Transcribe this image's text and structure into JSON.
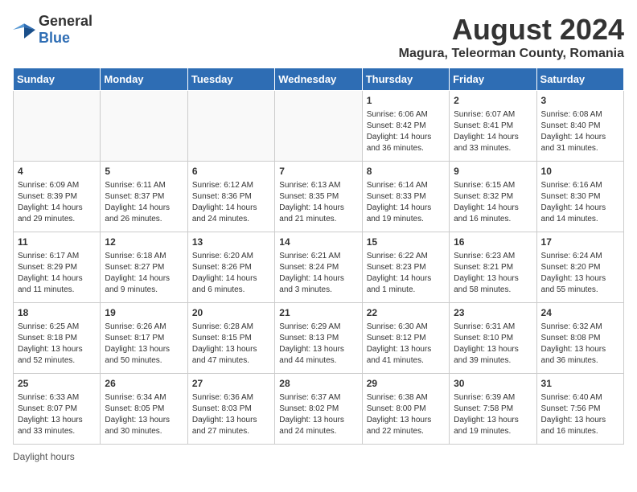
{
  "header": {
    "logo_general": "General",
    "logo_blue": "Blue",
    "title": "August 2024",
    "subtitle": "Magura, Teleorman County, Romania"
  },
  "weekdays": [
    "Sunday",
    "Monday",
    "Tuesday",
    "Wednesday",
    "Thursday",
    "Friday",
    "Saturday"
  ],
  "footer": {
    "daylight_label": "Daylight hours"
  },
  "weeks": [
    [
      {
        "day": "",
        "info": ""
      },
      {
        "day": "",
        "info": ""
      },
      {
        "day": "",
        "info": ""
      },
      {
        "day": "",
        "info": ""
      },
      {
        "day": "1",
        "info": "Sunrise: 6:06 AM\nSunset: 8:42 PM\nDaylight: 14 hours\nand 36 minutes."
      },
      {
        "day": "2",
        "info": "Sunrise: 6:07 AM\nSunset: 8:41 PM\nDaylight: 14 hours\nand 33 minutes."
      },
      {
        "day": "3",
        "info": "Sunrise: 6:08 AM\nSunset: 8:40 PM\nDaylight: 14 hours\nand 31 minutes."
      }
    ],
    [
      {
        "day": "4",
        "info": "Sunrise: 6:09 AM\nSunset: 8:39 PM\nDaylight: 14 hours\nand 29 minutes."
      },
      {
        "day": "5",
        "info": "Sunrise: 6:11 AM\nSunset: 8:37 PM\nDaylight: 14 hours\nand 26 minutes."
      },
      {
        "day": "6",
        "info": "Sunrise: 6:12 AM\nSunset: 8:36 PM\nDaylight: 14 hours\nand 24 minutes."
      },
      {
        "day": "7",
        "info": "Sunrise: 6:13 AM\nSunset: 8:35 PM\nDaylight: 14 hours\nand 21 minutes."
      },
      {
        "day": "8",
        "info": "Sunrise: 6:14 AM\nSunset: 8:33 PM\nDaylight: 14 hours\nand 19 minutes."
      },
      {
        "day": "9",
        "info": "Sunrise: 6:15 AM\nSunset: 8:32 PM\nDaylight: 14 hours\nand 16 minutes."
      },
      {
        "day": "10",
        "info": "Sunrise: 6:16 AM\nSunset: 8:30 PM\nDaylight: 14 hours\nand 14 minutes."
      }
    ],
    [
      {
        "day": "11",
        "info": "Sunrise: 6:17 AM\nSunset: 8:29 PM\nDaylight: 14 hours\nand 11 minutes."
      },
      {
        "day": "12",
        "info": "Sunrise: 6:18 AM\nSunset: 8:27 PM\nDaylight: 14 hours\nand 9 minutes."
      },
      {
        "day": "13",
        "info": "Sunrise: 6:20 AM\nSunset: 8:26 PM\nDaylight: 14 hours\nand 6 minutes."
      },
      {
        "day": "14",
        "info": "Sunrise: 6:21 AM\nSunset: 8:24 PM\nDaylight: 14 hours\nand 3 minutes."
      },
      {
        "day": "15",
        "info": "Sunrise: 6:22 AM\nSunset: 8:23 PM\nDaylight: 14 hours\nand 1 minute."
      },
      {
        "day": "16",
        "info": "Sunrise: 6:23 AM\nSunset: 8:21 PM\nDaylight: 13 hours\nand 58 minutes."
      },
      {
        "day": "17",
        "info": "Sunrise: 6:24 AM\nSunset: 8:20 PM\nDaylight: 13 hours\nand 55 minutes."
      }
    ],
    [
      {
        "day": "18",
        "info": "Sunrise: 6:25 AM\nSunset: 8:18 PM\nDaylight: 13 hours\nand 52 minutes."
      },
      {
        "day": "19",
        "info": "Sunrise: 6:26 AM\nSunset: 8:17 PM\nDaylight: 13 hours\nand 50 minutes."
      },
      {
        "day": "20",
        "info": "Sunrise: 6:28 AM\nSunset: 8:15 PM\nDaylight: 13 hours\nand 47 minutes."
      },
      {
        "day": "21",
        "info": "Sunrise: 6:29 AM\nSunset: 8:13 PM\nDaylight: 13 hours\nand 44 minutes."
      },
      {
        "day": "22",
        "info": "Sunrise: 6:30 AM\nSunset: 8:12 PM\nDaylight: 13 hours\nand 41 minutes."
      },
      {
        "day": "23",
        "info": "Sunrise: 6:31 AM\nSunset: 8:10 PM\nDaylight: 13 hours\nand 39 minutes."
      },
      {
        "day": "24",
        "info": "Sunrise: 6:32 AM\nSunset: 8:08 PM\nDaylight: 13 hours\nand 36 minutes."
      }
    ],
    [
      {
        "day": "25",
        "info": "Sunrise: 6:33 AM\nSunset: 8:07 PM\nDaylight: 13 hours\nand 33 minutes."
      },
      {
        "day": "26",
        "info": "Sunrise: 6:34 AM\nSunset: 8:05 PM\nDaylight: 13 hours\nand 30 minutes."
      },
      {
        "day": "27",
        "info": "Sunrise: 6:36 AM\nSunset: 8:03 PM\nDaylight: 13 hours\nand 27 minutes."
      },
      {
        "day": "28",
        "info": "Sunrise: 6:37 AM\nSunset: 8:02 PM\nDaylight: 13 hours\nand 24 minutes."
      },
      {
        "day": "29",
        "info": "Sunrise: 6:38 AM\nSunset: 8:00 PM\nDaylight: 13 hours\nand 22 minutes."
      },
      {
        "day": "30",
        "info": "Sunrise: 6:39 AM\nSunset: 7:58 PM\nDaylight: 13 hours\nand 19 minutes."
      },
      {
        "day": "31",
        "info": "Sunrise: 6:40 AM\nSunset: 7:56 PM\nDaylight: 13 hours\nand 16 minutes."
      }
    ]
  ]
}
